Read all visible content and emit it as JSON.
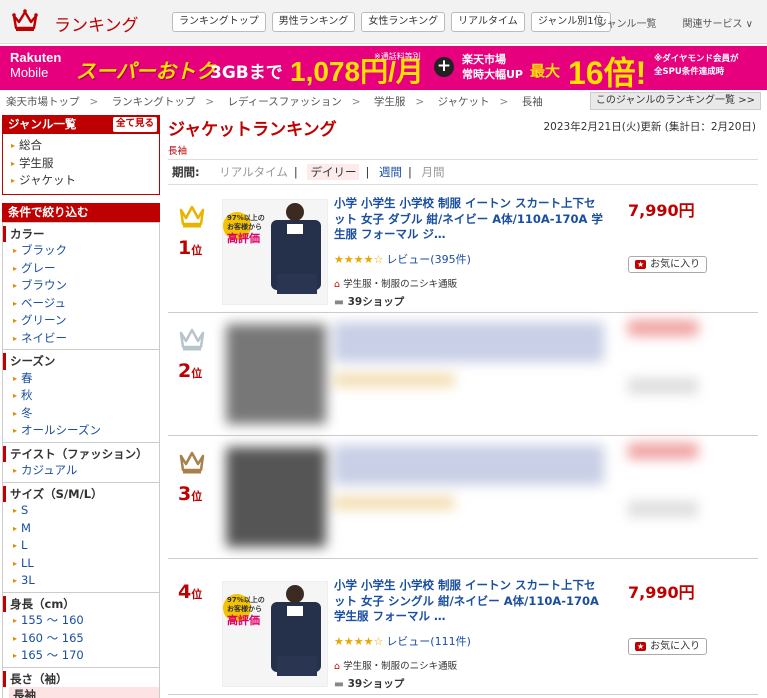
{
  "header": {
    "brand": "ランキング",
    "tabs": [
      "ランキングトップ",
      "男性ランキング",
      "女性ランキング",
      "リアルタイム",
      "ジャンル別1位"
    ],
    "links": [
      "ジャンル一覧",
      "関連サービス ∨"
    ]
  },
  "banner": {
    "brand_line1": "Rakuten",
    "brand_line2": "Mobile",
    "super": "スーパーおトク",
    "data": "3GBまで",
    "price": "1,078円/月",
    "price_note": "※通話料等別",
    "plus": "+",
    "ichiba_line1": "楽天市場",
    "ichiba_line2": "常時大幅UP",
    "max": "最大",
    "times": "16倍!",
    "note_line1": "※ダイヤモンド会員が",
    "note_line2": "全SPU条件達成時"
  },
  "breadcrumb": [
    "楽天市場トップ",
    "ランキングトップ",
    "レディースファッション",
    "学生服",
    "ジャケット",
    "長袖"
  ],
  "genre_ranking_link": "このジャンルのランキング一覧 >>",
  "sidebar": {
    "genre_title": "ジャンル一覧",
    "see_all": "全て見る",
    "genres": [
      "総合",
      "学生服",
      "ジャケット"
    ],
    "filter_title": "条件で絞り込む",
    "groups": [
      {
        "title": "カラー",
        "items": [
          "ブラック",
          "グレー",
          "ブラウン",
          "ベージュ",
          "グリーン",
          "ネイビー"
        ]
      },
      {
        "title": "シーズン",
        "items": [
          "春",
          "秋",
          "冬",
          "オールシーズン"
        ]
      },
      {
        "title": "テイスト（ファッション）",
        "items": [
          "カジュアル"
        ]
      },
      {
        "title": "サイズ（S/M/L）",
        "items": [
          "S",
          "M",
          "L",
          "LL",
          "3L"
        ]
      },
      {
        "title": "身長（cm）",
        "items": [
          "155 〜 160",
          "160 〜 165",
          "165 〜 170"
        ]
      },
      {
        "title": "長さ（袖）",
        "selected": "長袖"
      }
    ]
  },
  "main": {
    "title": "ジャケットランキング",
    "subcat": "長袖",
    "updated": "2023年2月21日(火)更新 (集計日：2月20日)",
    "period_label": "期間:",
    "periods": [
      "リアルタイム",
      "デイリー",
      "週間",
      "月間"
    ],
    "fav_label": "お気に入り",
    "items": [
      {
        "rank": "1",
        "unit": "位",
        "name": "小学 小学生 小学校 制服 イートン スカート上下セット 女子 ダブル 紺/ネイビー A体/110A-170A 学生服 フォーマル ジ…",
        "rating": "★★★★☆",
        "reviews": "レビュー(395件)",
        "shop": "学生服・制服のニシキ通販",
        "ship": "39ショップ",
        "price": "7,990円",
        "crown_color": "#e8b400",
        "thumb_badge1": "97%以上の",
        "thumb_badge2": "お客様から",
        "thumb_badge3": "高評価"
      },
      {
        "rank": "2",
        "unit": "位",
        "crown_color": "#b8c4cc"
      },
      {
        "rank": "3",
        "unit": "位",
        "crown_color": "#a8804a"
      },
      {
        "rank": "4",
        "unit": "位",
        "name": "小学 小学生 小学校 制服 イートン スカート上下セット 女子 シングル 紺/ネイビー A体/110A-170A 学生服 フォーマル …",
        "rating": "★★★★☆",
        "reviews": "レビュー(111件)",
        "shop": "学生服・制服のニシキ通販",
        "ship": "39ショップ",
        "price": "7,990円",
        "thumb_badge1": "97%以上の",
        "thumb_badge2": "お客様から",
        "thumb_badge3": "高評価"
      }
    ]
  }
}
